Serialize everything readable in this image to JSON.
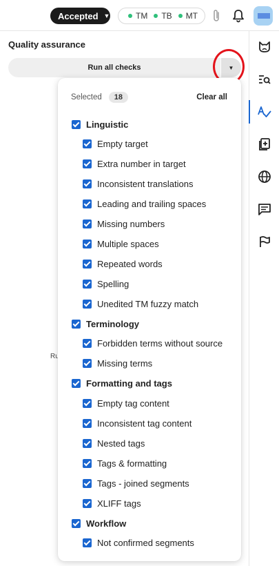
{
  "topbar": {
    "status_label": "Accepted",
    "resources": [
      "TM",
      "TB",
      "MT"
    ],
    "resource_dot_color": "#2fc07b"
  },
  "panel": {
    "title": "Quality assurance",
    "run_button_label": "Run all checks",
    "behind_text": "Ru"
  },
  "dropdown": {
    "selected_label": "Selected",
    "selected_count": "18",
    "clear_all_label": "Clear all",
    "groups": [
      {
        "label": "Linguistic",
        "checked": true,
        "items": [
          "Empty target",
          "Extra number in target",
          "Inconsistent translations",
          "Leading and trailing spaces",
          "Missing numbers",
          "Multiple spaces",
          "Repeated words",
          "Spelling",
          "Unedited TM fuzzy match"
        ]
      },
      {
        "label": "Terminology",
        "checked": true,
        "items": [
          "Forbidden terms without source",
          "Missing terms"
        ]
      },
      {
        "label": "Formatting and tags",
        "checked": true,
        "items": [
          "Empty tag content",
          "Inconsistent tag content",
          "Nested tags",
          "Tags & formatting",
          "Tags - joined segments",
          "XLIFF tags"
        ]
      },
      {
        "label": "Workflow",
        "checked": true,
        "items": [
          "Not confirmed segments"
        ]
      }
    ]
  },
  "sidebar": {
    "items": [
      "cat-icon",
      "search-list-icon",
      "qa-spellcheck-icon",
      "clipboard-icon",
      "globe-icon",
      "comments-icon",
      "flag-icon"
    ],
    "active_index": 2,
    "accent_color": "#1a66d0"
  },
  "annotation": {
    "highlight_color": "#e3131b"
  }
}
